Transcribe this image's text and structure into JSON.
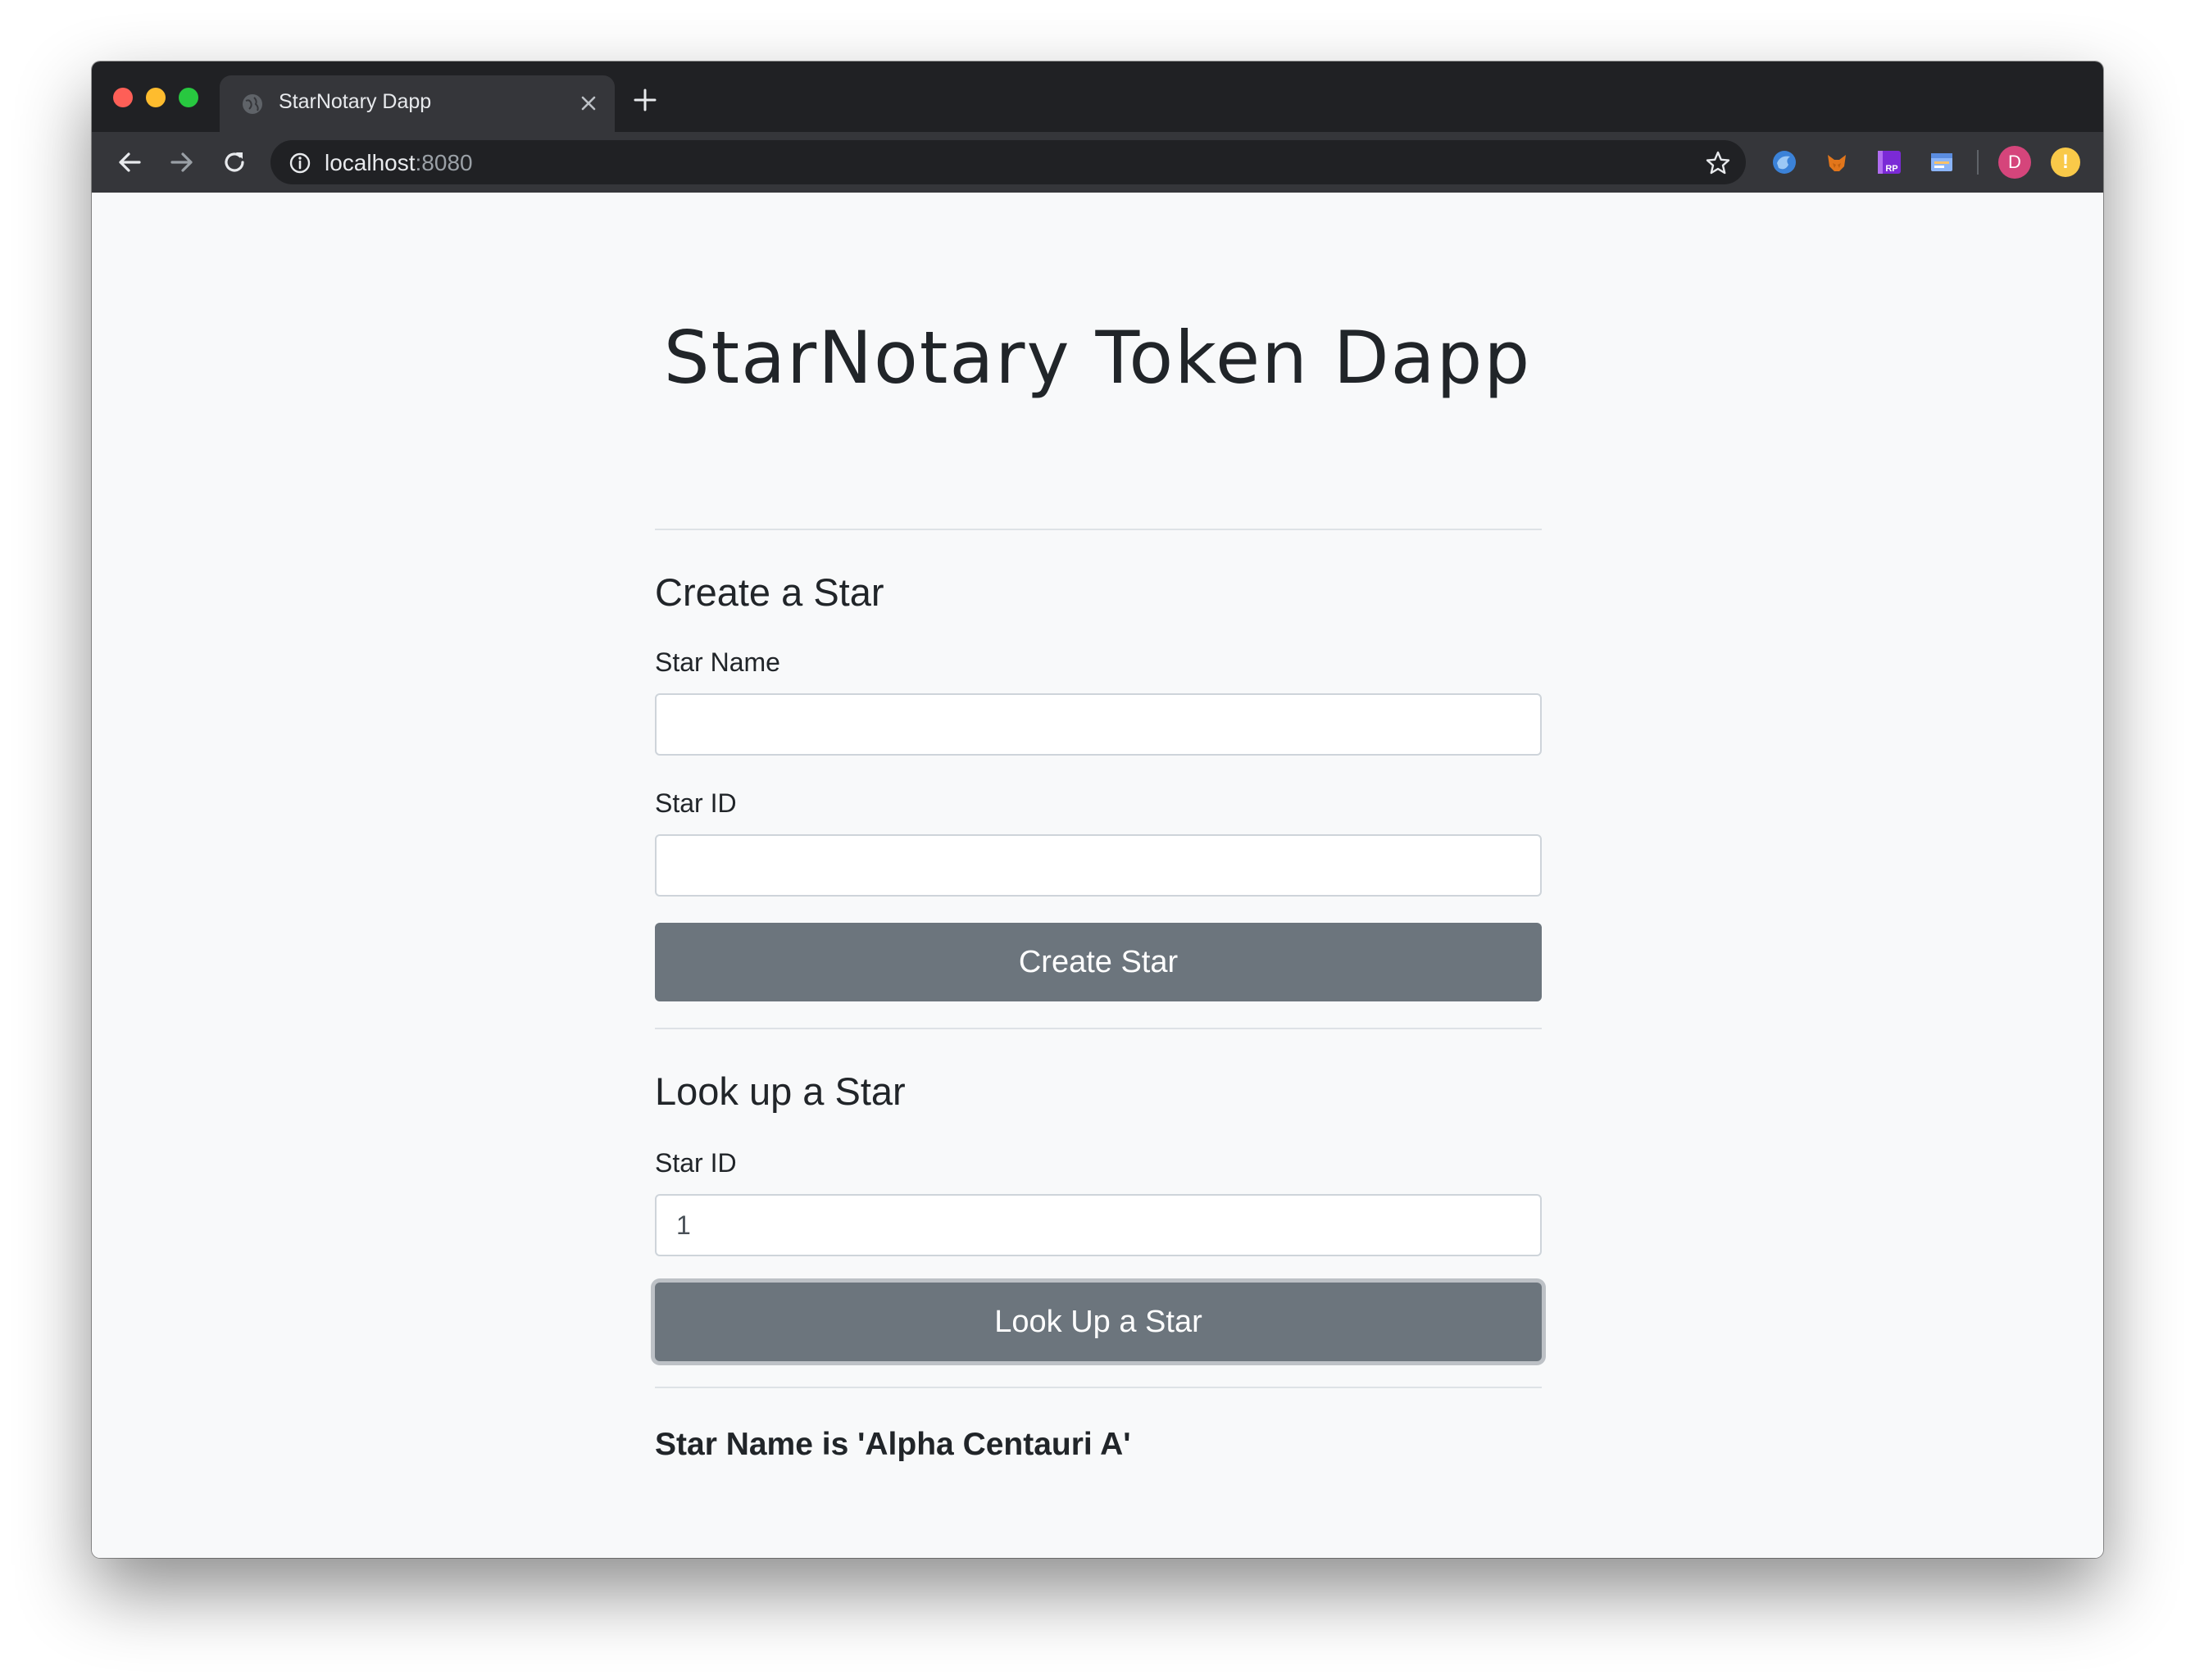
{
  "browser": {
    "tab_title": "StarNotary Dapp",
    "url_host": "localhost",
    "url_port": ":8080",
    "profile_initial": "D",
    "alert_glyph": "!"
  },
  "page": {
    "title": "StarNotary Token Dapp",
    "create": {
      "heading": "Create a Star",
      "name_label": "Star Name",
      "name_value": "",
      "id_label": "Star ID",
      "id_value": "",
      "button": "Create Star"
    },
    "lookup": {
      "heading": "Look up a Star",
      "id_label": "Star ID",
      "id_value": "1",
      "button": "Look Up a Star"
    },
    "status": "Star Name is 'Alpha Centauri A'"
  },
  "colors": {
    "button_bg": "#6c757d",
    "page_bg": "#f8f9fa",
    "chrome_dark": "#202124",
    "chrome_toolbar": "#35363a",
    "avatar": "#d5457b"
  },
  "icons": [
    "globe-icon",
    "close-icon",
    "plus-icon",
    "back-arrow-icon",
    "forward-arrow-icon",
    "reload-icon",
    "info-icon",
    "bookmark-star-icon",
    "firefox-style-extension-icon",
    "metamask-fox-icon",
    "rp-extension-icon",
    "window-extension-icon",
    "alert-icon"
  ]
}
